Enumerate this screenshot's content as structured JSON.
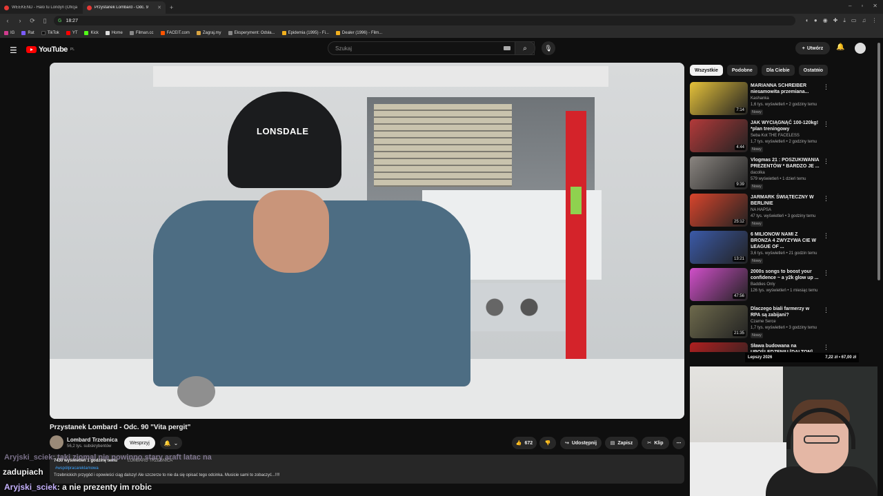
{
  "browser": {
    "tabs": [
      {
        "title": "WEEKEND - Halo tu Londyn (Oficjaln",
        "active": false
      },
      {
        "title": "Przystanek Lombard - Odc. 9",
        "active": true
      }
    ],
    "time": "18:27",
    "bookmarks": [
      "IG",
      "Rat",
      "TikTok",
      "YT",
      "Kick",
      "Home",
      "Filman.cc",
      "FACEIT.com",
      "Zagraj.my",
      "Eksperyment: Odsła...",
      "Epidemia (1995) - Fi...",
      "Dealer (1996) - Film..."
    ]
  },
  "youtube": {
    "logo": "YouTube",
    "logo_region": "PL",
    "search_placeholder": "Szukaj",
    "create_label": "Utwórz"
  },
  "video": {
    "title": "Przystanek Lombard - Odc. 90 \"Vita pergit\"",
    "channel": "Lombard Trzebnica",
    "subscribers": "56,2 tys. subskrybentów",
    "support_label": "Wesprzyj",
    "likes": "672",
    "share_label": "Udostępnij",
    "save_label": "Zapisz",
    "clip_label": "Klip",
    "cap_logo": "LONSDALE",
    "description": {
      "meta": "7430 wyświetleń  1 godzinę temu",
      "tag": "LOMBARD TRZEBNICA",
      "hashtag": "#współpracareklamowa",
      "text": "Trzebnickich przygód i opowieści ciąg dalszy! Ale szczerze to nie da się opisać tego odcinka. Musicie sami to zobaczyć...!!!!"
    }
  },
  "chat": {
    "overlay_line": "Aryjski_sciek: taki ziomal nie powinno stary araft latac na",
    "overlay_word": "zadupiach",
    "user": "Aryjski_sciek",
    "message": ": a nie prezenty im robic"
  },
  "sidebar": {
    "chips": [
      "Wszystkie",
      "Podobne",
      "Dla Ciebie",
      "Ostatnio"
    ],
    "recommendations": [
      {
        "title": "MARIANNA SCHREIBER niesamowita przemiana...",
        "channel": "Kashanka",
        "views": "1,6 tys. wyświetleń • 2 godziny temu",
        "badge": "Nowy",
        "duration": "7:14",
        "color": "#e6c23a"
      },
      {
        "title": "JAK WYCIĄGNĄĆ 100-120kg! *plan treningowy",
        "channel": "Seba Kot THE FACELESS",
        "views": "1,7 tys. wyświetleń • 2 godziny temu",
        "badge": "Nowy",
        "duration": "4:44",
        "color": "#b33a3a"
      },
      {
        "title": "Vlogmas 21 : POSZUKIWANIA PREZENTÓW * BARDZO JE ...",
        "channel": "dacolka",
        "views": "579 wyświetleń • 1 dzień temu",
        "badge": "Nowy",
        "duration": "9:39",
        "color": "#8a8580"
      },
      {
        "title": "JARMARK ŚWIĄTECZNY W BERLINIE",
        "channel": "NA HAPSA",
        "views": "47 tys. wyświetleń • 3 godziny temu",
        "badge": "Nowy",
        "duration": "25:12",
        "color": "#d8452c"
      },
      {
        "title": "6 MILIONOW NAMI Z BRONZA 4 ZWYZYWA CIE W LEAGUE OF ...",
        "channel": "Nil",
        "views": "3,6 tys. wyświetleń • 21 godzin temu",
        "badge": "Nowy",
        "duration": "13:21",
        "color": "#3b5aa8"
      },
      {
        "title": "2000s songs to boost your confidence ~ a y2k glow up ...",
        "channel": "Baddies Only",
        "views": "126 tys. wyświetleń • 1 miesiąc temu",
        "badge": "",
        "duration": "47:56",
        "color": "#d04fc9"
      },
      {
        "title": "Dlaczego biali farmerzy w RPA są zabijani?",
        "channel": "Czarne Serce",
        "views": "1,7 tys. wyświetleń • 3 godziny temu",
        "badge": "Nowy",
        "duration": "21:35",
        "color": "#6e6a4c"
      },
      {
        "title": "Sława budowana na UPOŚLEDZENIU [DALTON]",
        "channel": "",
        "views": "",
        "badge": "",
        "duration": "",
        "color": "#b02020"
      }
    ]
  },
  "ticker": {
    "left": "Lepszy 2026",
    "right": "7,22 zł • 67,00 zł"
  }
}
